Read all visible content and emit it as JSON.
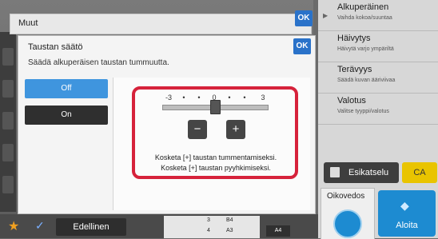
{
  "header": {
    "title": "Muut",
    "ok_label": "OK"
  },
  "dialog": {
    "title": "Taustan säätö",
    "subtitle": "Säädä alkuperäisen taustan tummuutta.",
    "ok_label": "OK",
    "options": [
      {
        "label": "Off",
        "selected": true
      },
      {
        "label": "On",
        "selected": false
      }
    ],
    "slider": {
      "tick_labels": [
        "-3",
        "•",
        "•",
        "0",
        "•",
        "•",
        "3"
      ],
      "value": 0,
      "min": -3,
      "max": 3,
      "minus_label": "−",
      "plus_label": "+"
    },
    "hints": [
      "Kosketa [+] taustan tummentamiseksi.",
      "Kosketa [+] taustan pyyhkimiseksi."
    ]
  },
  "right_panel": {
    "items": [
      {
        "title": "Alkuperäinen",
        "subtitle": "Vaihda kokoa/suuntaa"
      },
      {
        "title": "Häivytys",
        "subtitle": "Häivytä varjo ympäriltä"
      },
      {
        "title": "Terävyys",
        "subtitle": "Säädä kuvan ääriviivaa"
      },
      {
        "title": "Valotus",
        "subtitle": "Valitse tyyppi/valotus"
      }
    ],
    "preview_label": "Esikatselu",
    "ca_label": "CA",
    "tab_label": "Oikovedos",
    "start_label": "Aloita"
  },
  "bottom_bar": {
    "prev_label": "Edellinen",
    "tray_lines": [
      "3",
      "B4",
      "4",
      "A3"
    ],
    "paper_badge": "A4"
  },
  "colors": {
    "accent_blue": "#2a72c9",
    "selected_option": "#3f95de",
    "highlight_red": "#d6223b",
    "ca_yellow": "#e9c400"
  }
}
